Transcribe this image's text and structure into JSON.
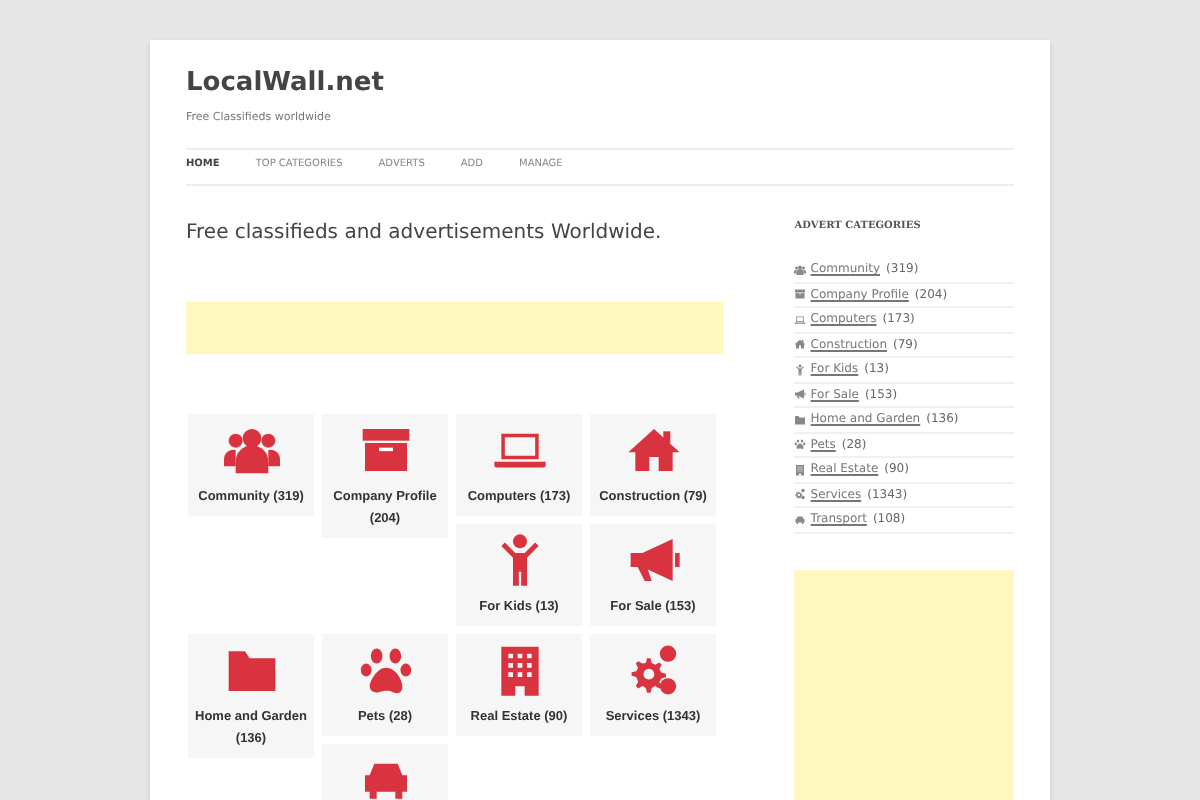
{
  "site": {
    "title": "LocalWall.net",
    "tagline": "Free Classifieds worldwide"
  },
  "nav": [
    {
      "label": "HOME",
      "selected": true
    },
    {
      "label": "TOP CATEGORIES",
      "selected": false
    },
    {
      "label": "ADVERTS",
      "selected": false
    },
    {
      "label": "ADD",
      "selected": false
    },
    {
      "label": "MANAGE",
      "selected": false
    }
  ],
  "intro": "Free classifieds and advertisements Worldwide.",
  "tiles": [
    {
      "kind": "users",
      "label": "Community (319)"
    },
    {
      "kind": "box",
      "label": "Company Profile (204)"
    },
    {
      "kind": "laptop",
      "label": "Computers (173)"
    },
    {
      "kind": "house",
      "label": "Construction (79)"
    },
    {
      "kind": "child",
      "label": "For Kids (13)"
    },
    {
      "kind": "megaphone",
      "label": "For Sale (153)"
    },
    {
      "kind": "folder",
      "label": "Home and Garden (136)"
    },
    {
      "kind": "paw",
      "label": "Pets (28)"
    },
    {
      "kind": "building",
      "label": "Real Estate (90)"
    },
    {
      "kind": "gears",
      "label": "Services (1343)"
    },
    {
      "kind": "car"
    }
  ],
  "sidebar": {
    "heading": "ADVERT CATEGORIES",
    "items": [
      {
        "kind": "users",
        "link": "Community",
        "count": "(319)"
      },
      {
        "kind": "box",
        "link": "Company Profile",
        "count": "(204)"
      },
      {
        "kind": "laptop",
        "link": "Computers",
        "count": "(173)"
      },
      {
        "kind": "house",
        "link": "Construction",
        "count": "(79)"
      },
      {
        "kind": "child",
        "link": "For Kids",
        "count": "(13)"
      },
      {
        "kind": "megaphone",
        "link": "For Sale",
        "count": "(153)"
      },
      {
        "kind": "folder",
        "link": "Home and Garden",
        "count": "(136)"
      },
      {
        "kind": "paw",
        "link": "Pets",
        "count": "(28)"
      },
      {
        "kind": "building",
        "link": "Real Estate",
        "count": "(90)"
      },
      {
        "kind": "gears",
        "link": "Services",
        "count": "(1343)"
      },
      {
        "kind": "car",
        "link": "Transport",
        "count": "(108)"
      }
    ]
  }
}
